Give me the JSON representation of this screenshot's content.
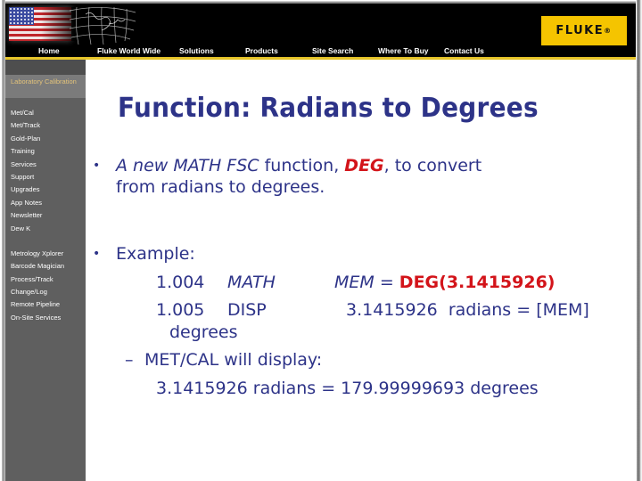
{
  "header": {
    "nav": [
      "Home",
      "Fluke World Wide",
      "Solutions",
      "Products",
      "Site Search",
      "Where To Buy",
      "Contact Us"
    ],
    "logo": "FLUKE",
    "logo_mark": "®"
  },
  "sidebar": {
    "section_title": "Laboratory Calibration",
    "items": [
      "Met/Cal",
      "Met/Track",
      "Gold-Plan",
      "Training",
      "Services",
      "Support",
      "Upgrades",
      "App Notes",
      "Newsletter",
      "Dew K"
    ],
    "items2": [
      "Metrology Xplorer",
      "Barcode Magician",
      "Process/Track",
      "Change/Log",
      "Remote Pipeline",
      "On-Site Services"
    ]
  },
  "slide": {
    "title": "Function: Radians to Degrees",
    "bullet1": {
      "pre": "A new ",
      "italic": "MATH FSC",
      "mid": " function, ",
      "highlight": "DEG",
      "post": ", to convert",
      "line2": "from radians to degrees."
    },
    "bullet2": {
      "label": "Example:",
      "line1_step": "1.004",
      "line1_fsc": "MATH",
      "line1_expr_pre": "MEM = ",
      "line1_expr_red": "DEG(3.1415926)",
      "line2_step": "1.005",
      "line2_fsc": "DISP",
      "line2_expr": "3.1415926  radians = [MEM]",
      "line3": "degrees",
      "sub_label": "MET/CAL will display:",
      "sub_value": "3.1415926 radians = 179.99999693 degrees"
    }
  }
}
